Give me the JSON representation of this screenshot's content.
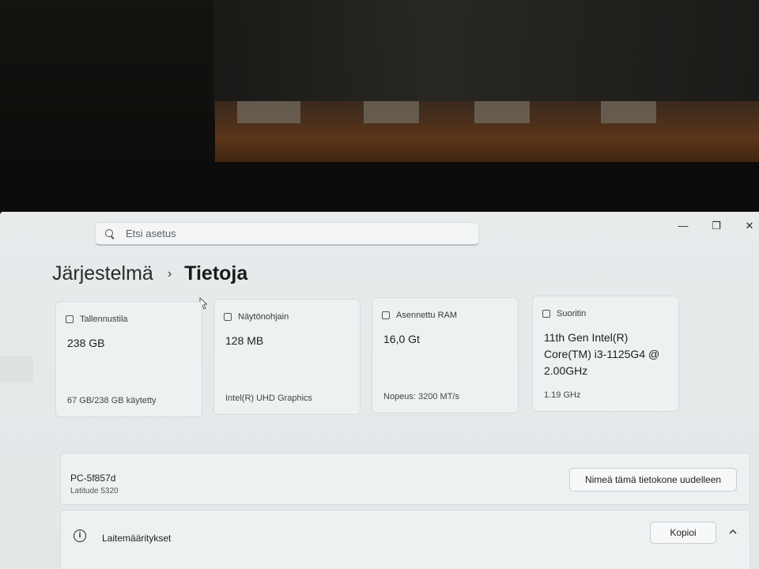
{
  "window": {
    "minimize_glyph": "—",
    "maximize_glyph": "❐",
    "close_glyph": "✕"
  },
  "search": {
    "placeholder": "Etsi asetus"
  },
  "breadcrumb": {
    "parent": "Järjestelmä",
    "separator": "›",
    "current": "Tietoja"
  },
  "cards": [
    {
      "title": "Tallennustila",
      "value": "238 GB",
      "sub": "67 GB/238 GB käytetty",
      "icon": "storage-icon"
    },
    {
      "title": "Näytönohjain",
      "value": "128 MB",
      "sub": "Intel(R) UHD Graphics",
      "icon": "display-adapter-icon"
    },
    {
      "title": "Asennettu RAM",
      "value": "16,0 Gt",
      "sub": "Nopeus: 3200 MT/s",
      "icon": "ram-icon"
    },
    {
      "title": "Suoritin",
      "value": "11th Gen Intel(R) Core(TM) i3-1125G4 @ 2.00GHz",
      "sub": "1.19 GHz",
      "icon": "processor-icon"
    }
  ],
  "device": {
    "name": "PC-5f857d",
    "model": "Latitude 5320",
    "rename_label": "Nimeä tämä tietokone uudelleen"
  },
  "specs": {
    "title": "Laitemääritykset",
    "copy_label": "Kopioi",
    "info_glyph": "i"
  }
}
